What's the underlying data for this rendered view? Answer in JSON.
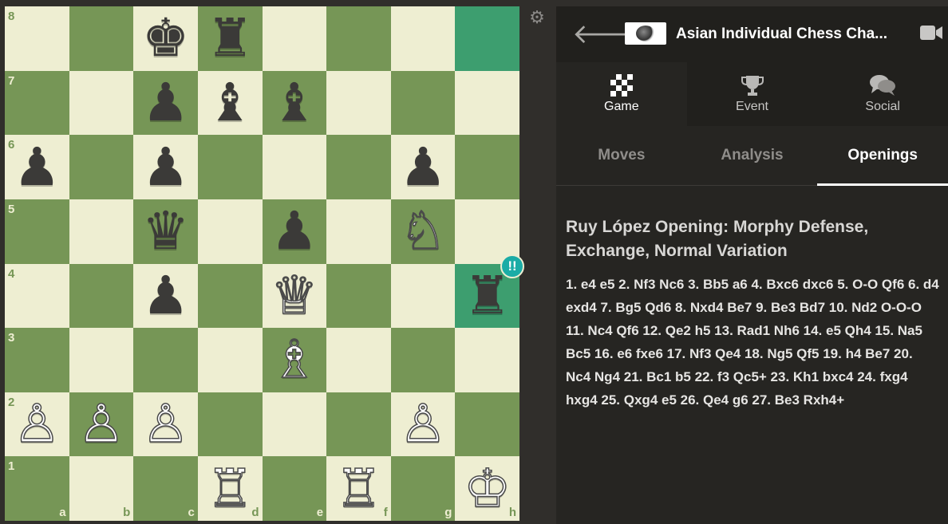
{
  "board": {
    "ranks": [
      "8",
      "7",
      "6",
      "5",
      "4",
      "3",
      "2",
      "1"
    ],
    "files": [
      "a",
      "b",
      "c",
      "d",
      "e",
      "f",
      "g",
      "h"
    ],
    "squares": [
      [
        null,
        null,
        "bk",
        "br",
        null,
        null,
        null,
        null
      ],
      [
        null,
        null,
        "bp",
        "bb",
        "bb",
        null,
        null,
        null
      ],
      [
        "bp",
        null,
        "bp",
        null,
        null,
        null,
        "bp",
        null
      ],
      [
        null,
        null,
        "bq",
        null,
        "bp",
        null,
        "wn",
        null
      ],
      [
        null,
        null,
        "bp",
        null,
        "wq",
        null,
        null,
        "br"
      ],
      [
        null,
        null,
        null,
        null,
        "wb",
        null,
        null,
        null
      ],
      [
        "wp",
        "wp",
        "wp",
        null,
        null,
        null,
        "wp",
        null
      ],
      [
        null,
        null,
        null,
        "wr",
        null,
        "wr",
        null,
        "wk"
      ]
    ],
    "highlights": [
      "h8",
      "h4"
    ],
    "annotation": {
      "square": "h4",
      "label": "!!"
    },
    "colors": {
      "light": "#eeeed2",
      "dark": "#769656",
      "highlight": "#4cad7d",
      "brilliant": "#1baca6"
    }
  },
  "settings_icon": "gear-icon",
  "header": {
    "back_icon": "arrow-left-icon",
    "event_title": "Asian Individual Chess Cha...",
    "video_icon": "video-camera-icon"
  },
  "main_tabs": [
    {
      "label": "Game",
      "icon": "chessboard-icon",
      "active": true
    },
    {
      "label": "Event",
      "icon": "trophy-icon",
      "active": false
    },
    {
      "label": "Social",
      "icon": "chat-bubbles-icon",
      "active": false
    }
  ],
  "sub_tabs": [
    {
      "label": "Moves",
      "active": false
    },
    {
      "label": "Analysis",
      "active": false
    },
    {
      "label": "Openings",
      "active": true
    }
  ],
  "opening": {
    "name": "Ruy López Opening: Morphy Defense, Exchange, Normal Variation",
    "moves": "1. e4 e5 2. Nf3 Nc6 3. Bb5 a6 4. Bxc6 dxc6 5. O-O Qf6 6. d4 exd4 7. Bg5 Qd6 8. Nxd4 Be7 9. Be3 Bd7 10. Nd2 O-O-O 11. Nc4 Qf6 12. Qe2 h5 13. Rad1 Nh6 14. e5 Qh4 15. Na5 Bc5 16. e6 fxe6 17. Nf3 Qe4 18. Ng5 Qf5 19. h4 Be7 20. Nc4 Ng4 21. Bc1 b5 22. f3 Qc5+ 23. Kh1 bxc4 24. fxg4 hxg4 25. Qxg4 e5 26. Qe4 g6 27. Be3 Rxh4+"
  }
}
